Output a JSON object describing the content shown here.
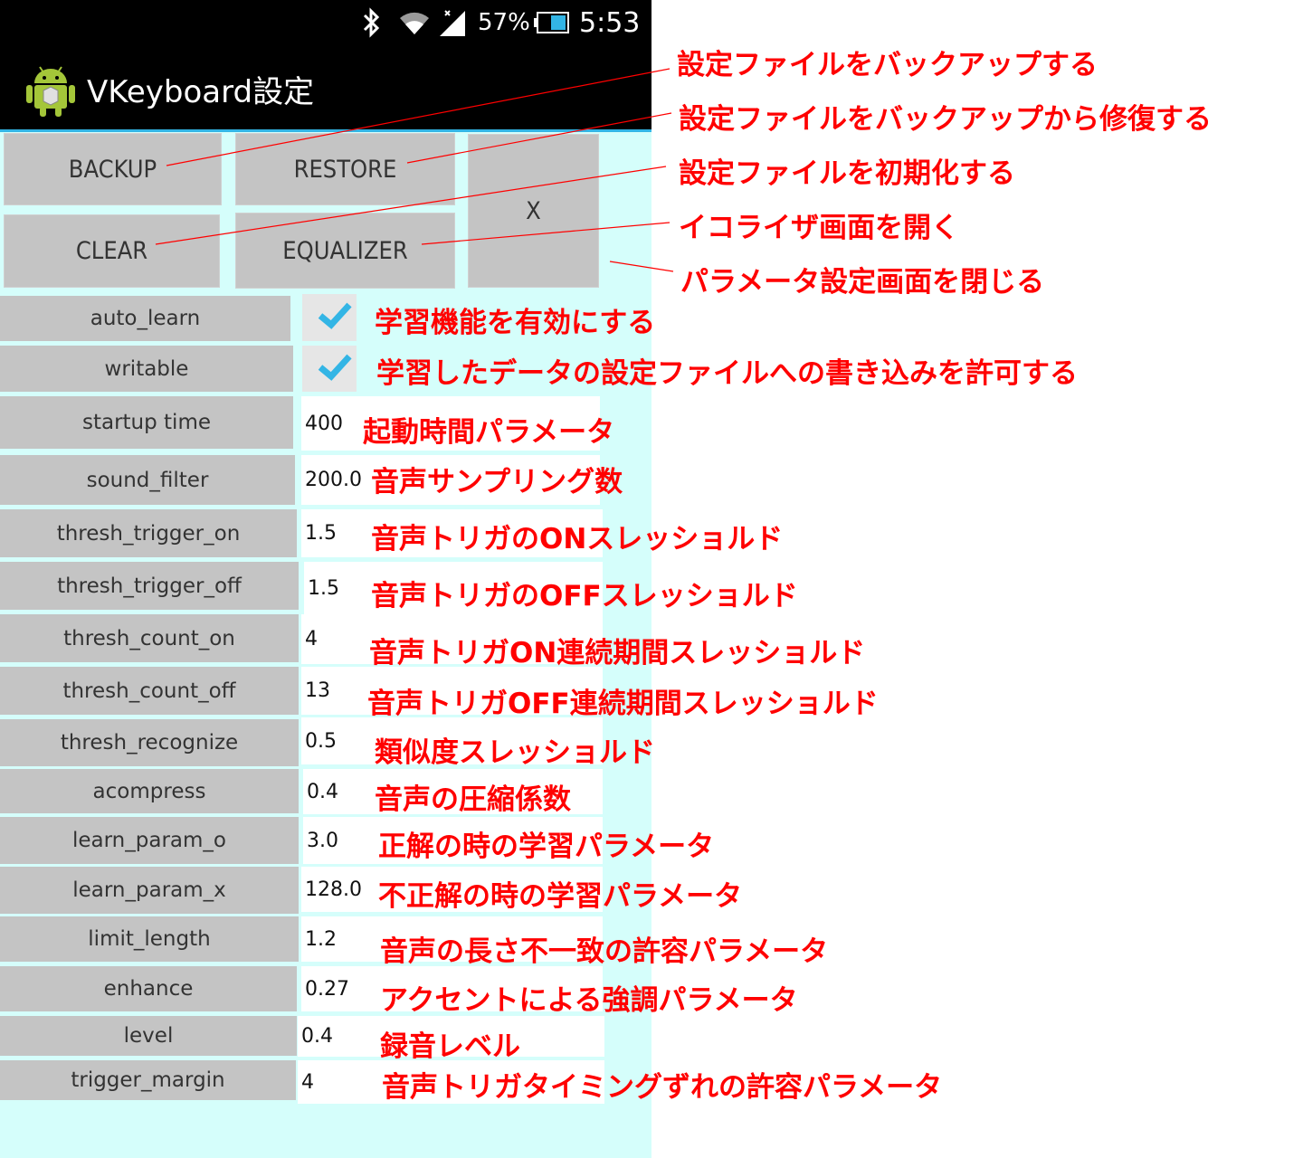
{
  "status_bar": {
    "battery": "57%",
    "time": "5:53"
  },
  "app": {
    "title": "VKeyboard設定"
  },
  "buttons": {
    "backup": "BACKUP",
    "restore": "RESTORE",
    "clear": "CLEAR",
    "equalizer": "EQUALIZER",
    "close": "X"
  },
  "params": {
    "auto_learn": {
      "label": "auto_learn",
      "checked": true
    },
    "writable": {
      "label": "writable",
      "checked": true
    },
    "startup_time": {
      "label": "startup time",
      "value": "400"
    },
    "sound_filter": {
      "label": "sound_filter",
      "value": "200.0"
    },
    "thresh_trigger_on": {
      "label": "thresh_trigger_on",
      "value": "1.5"
    },
    "thresh_trigger_off": {
      "label": "thresh_trigger_off",
      "value": "1.5"
    },
    "thresh_count_on": {
      "label": "thresh_count_on",
      "value": "4"
    },
    "thresh_count_off": {
      "label": "thresh_count_off",
      "value": "13"
    },
    "thresh_recognize": {
      "label": "thresh_recognize",
      "value": "0.5"
    },
    "acompress": {
      "label": "acompress",
      "value": "0.4"
    },
    "learn_param_o": {
      "label": "learn_param_o",
      "value": "3.0"
    },
    "learn_param_x": {
      "label": "learn_param_x",
      "value": "128.0"
    },
    "limit_length": {
      "label": "limit_length",
      "value": "1.2"
    },
    "enhance": {
      "label": "enhance",
      "value": "0.27"
    },
    "level": {
      "label": "level",
      "value": "0.4"
    },
    "trigger_margin": {
      "label": "trigger_margin",
      "value": "4"
    }
  },
  "annotations": {
    "backup": "設定ファイルをバックアップする",
    "restore": "設定ファイルをバックアップから修復する",
    "clear": "設定ファイルを初期化する",
    "equalizer": "イコライザ画面を開く",
    "close": "パラメータ設定画面を閉じる",
    "auto_learn": "学習機能を有効にする",
    "writable": "学習したデータの設定ファイルへの書き込みを許可する",
    "startup_time": "起動時間パラメータ",
    "sound_filter": "音声サンプリング数",
    "thresh_trigger_on": "音声トリガのONスレッショルド",
    "thresh_trigger_off": "音声トリガのOFFスレッショルド",
    "thresh_count_on": "音声トリガON連続期間スレッショルド",
    "thresh_count_off": "音声トリガOFF連続期間スレッショルド",
    "thresh_recognize": "類似度スレッショルド",
    "acompress": "音声の圧縮係数",
    "learn_param_o": "正解の時の学習パラメータ",
    "learn_param_x": "不正解の時の学習パラメータ",
    "limit_length": "音声の長さ不一致の許容パラメータ",
    "enhance": "アクセントによる強調パラメータ",
    "level": "録音レベル",
    "trigger_margin": "音声トリガタイミングずれの許容パラメータ"
  },
  "colors": {
    "background": "#d5fefb",
    "button": "#c4c4c4",
    "annotation": "#ff0000",
    "accent": "#33b5e5",
    "checkmark": "#33b5e5"
  },
  "icons": [
    "bluetooth-icon",
    "wifi-icon",
    "signal-icon",
    "battery-icon",
    "android-app-icon",
    "checkmark-icon"
  ]
}
